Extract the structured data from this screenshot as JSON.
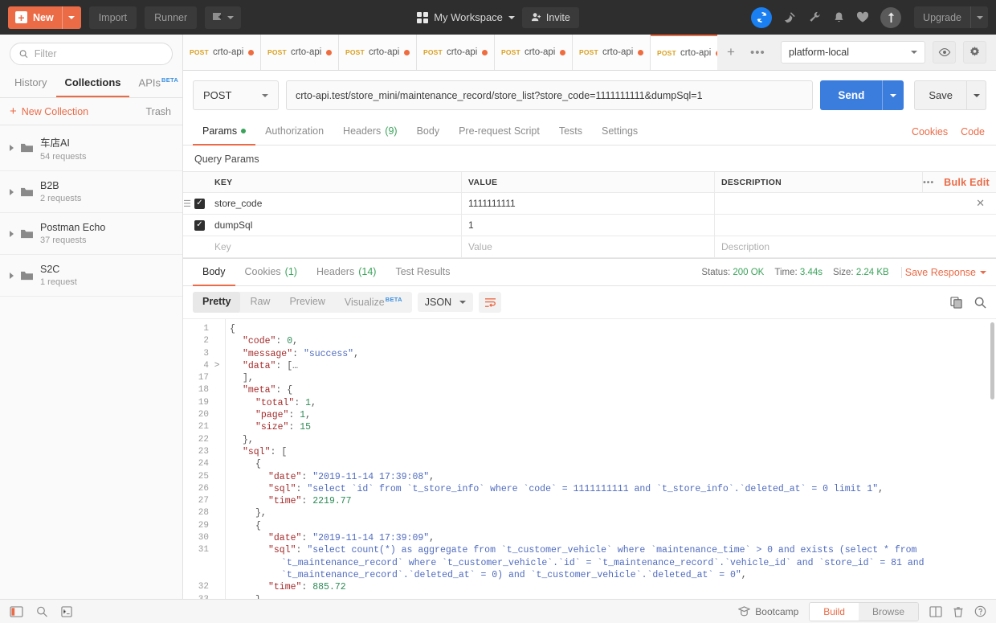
{
  "topbar": {
    "new_label": "New",
    "import_label": "Import",
    "runner_label": "Runner",
    "workspace_label": "My Workspace",
    "invite_label": "Invite",
    "upgrade_label": "Upgrade",
    "icons": [
      "sync-icon",
      "satellite-icon",
      "wrench-icon",
      "bell-icon",
      "heart-icon",
      "upload-icon"
    ]
  },
  "sidebar": {
    "filter_placeholder": "Filter",
    "tabs": [
      {
        "label": "History",
        "active": false
      },
      {
        "label": "Collections",
        "active": true
      },
      {
        "label": "APIs",
        "active": false,
        "sup": "BETA"
      }
    ],
    "new_collection_label": "New Collection",
    "trash_label": "Trash",
    "collections": [
      {
        "name": "车店AI",
        "requests": "54 requests"
      },
      {
        "name": "B2B",
        "requests": "2 requests"
      },
      {
        "name": "Postman Echo",
        "requests": "37 requests"
      },
      {
        "name": "S2C",
        "requests": "1 request"
      }
    ]
  },
  "request_tabs": [
    {
      "method": "POST",
      "name": "crto-api....",
      "unsaved": true,
      "active": false
    },
    {
      "method": "POST",
      "name": "crto-api....",
      "unsaved": true,
      "active": false
    },
    {
      "method": "POST",
      "name": "crto-api....",
      "unsaved": true,
      "active": false
    },
    {
      "method": "POST",
      "name": "crto-api....",
      "unsaved": true,
      "active": false
    },
    {
      "method": "POST",
      "name": "crto-api....",
      "unsaved": true,
      "active": false
    },
    {
      "method": "POST",
      "name": "crto-api....",
      "unsaved": true,
      "active": false
    },
    {
      "method": "POST",
      "name": "crto-api....",
      "unsaved": true,
      "active": true
    }
  ],
  "environment": {
    "selected": "platform-local"
  },
  "url_row": {
    "method": "POST",
    "url": "crto-api.test/store_mini/maintenance_record/store_list?store_code=1111111111&dumpSql=1",
    "send_label": "Send",
    "save_label": "Save"
  },
  "request_tabstrip": {
    "tabs": [
      {
        "label": "Params",
        "active": true,
        "dot": true
      },
      {
        "label": "Authorization",
        "active": false
      },
      {
        "label": "Headers",
        "active": false,
        "count": "(9)"
      },
      {
        "label": "Body",
        "active": false
      },
      {
        "label": "Pre-request Script",
        "active": false
      },
      {
        "label": "Tests",
        "active": false
      },
      {
        "label": "Settings",
        "active": false
      }
    ],
    "cookies_label": "Cookies",
    "code_label": "Code"
  },
  "params": {
    "section_title": "Query Params",
    "headers": {
      "key": "KEY",
      "value": "VALUE",
      "description": "DESCRIPTION",
      "bulk_edit": "Bulk Edit"
    },
    "rows": [
      {
        "checked": true,
        "key": "store_code",
        "value": "1111111111",
        "description": ""
      },
      {
        "checked": true,
        "key": "dumpSql",
        "value": "1",
        "description": ""
      }
    ],
    "placeholder_row": {
      "key": "Key",
      "value": "Value",
      "description": "Description"
    }
  },
  "response": {
    "tabs": [
      {
        "label": "Body",
        "active": true
      },
      {
        "label": "Cookies",
        "active": false,
        "count": "(1)"
      },
      {
        "label": "Headers",
        "active": false,
        "count": "(14)"
      },
      {
        "label": "Test Results",
        "active": false
      }
    ],
    "status_label": "Status:",
    "status_value": "200 OK",
    "time_label": "Time:",
    "time_value": "3.44s",
    "size_label": "Size:",
    "size_value": "2.24 KB",
    "save_response_label": "Save Response",
    "view_modes": [
      {
        "label": "Pretty",
        "active": true
      },
      {
        "label": "Raw",
        "active": false
      },
      {
        "label": "Preview",
        "active": false
      },
      {
        "label": "Visualize",
        "active": false,
        "sup": "BETA"
      }
    ],
    "format": "JSON",
    "code_lines": [
      {
        "num": "1",
        "fold": "",
        "indent": 0,
        "tokens": [
          {
            "t": "{",
            "c": "p"
          }
        ]
      },
      {
        "num": "2",
        "fold": "",
        "indent": 1,
        "tokens": [
          {
            "t": "\"code\"",
            "c": "k"
          },
          {
            "t": ": ",
            "c": "p"
          },
          {
            "t": "0",
            "c": "n"
          },
          {
            "t": ",",
            "c": "p"
          }
        ]
      },
      {
        "num": "3",
        "fold": "",
        "indent": 1,
        "tokens": [
          {
            "t": "\"message\"",
            "c": "k"
          },
          {
            "t": ": ",
            "c": "p"
          },
          {
            "t": "\"success\"",
            "c": "s"
          },
          {
            "t": ",",
            "c": "p"
          }
        ]
      },
      {
        "num": "4",
        "fold": ">",
        "indent": 1,
        "tokens": [
          {
            "t": "\"data\"",
            "c": "k"
          },
          {
            "t": ": […",
            "c": "p"
          }
        ]
      },
      {
        "num": "17",
        "fold": "",
        "indent": 1,
        "tokens": [
          {
            "t": "],",
            "c": "p"
          }
        ]
      },
      {
        "num": "18",
        "fold": "",
        "indent": 1,
        "tokens": [
          {
            "t": "\"meta\"",
            "c": "k"
          },
          {
            "t": ": {",
            "c": "p"
          }
        ]
      },
      {
        "num": "19",
        "fold": "",
        "indent": 2,
        "tokens": [
          {
            "t": "\"total\"",
            "c": "k"
          },
          {
            "t": ": ",
            "c": "p"
          },
          {
            "t": "1",
            "c": "n"
          },
          {
            "t": ",",
            "c": "p"
          }
        ]
      },
      {
        "num": "20",
        "fold": "",
        "indent": 2,
        "tokens": [
          {
            "t": "\"page\"",
            "c": "k"
          },
          {
            "t": ": ",
            "c": "p"
          },
          {
            "t": "1",
            "c": "n"
          },
          {
            "t": ",",
            "c": "p"
          }
        ]
      },
      {
        "num": "21",
        "fold": "",
        "indent": 2,
        "tokens": [
          {
            "t": "\"size\"",
            "c": "k"
          },
          {
            "t": ": ",
            "c": "p"
          },
          {
            "t": "15",
            "c": "n"
          }
        ]
      },
      {
        "num": "22",
        "fold": "",
        "indent": 1,
        "tokens": [
          {
            "t": "},",
            "c": "p"
          }
        ]
      },
      {
        "num": "23",
        "fold": "",
        "indent": 1,
        "tokens": [
          {
            "t": "\"sql\"",
            "c": "k"
          },
          {
            "t": ": [",
            "c": "p"
          }
        ]
      },
      {
        "num": "24",
        "fold": "",
        "indent": 2,
        "tokens": [
          {
            "t": "{",
            "c": "p"
          }
        ]
      },
      {
        "num": "25",
        "fold": "",
        "indent": 3,
        "tokens": [
          {
            "t": "\"date\"",
            "c": "k"
          },
          {
            "t": ": ",
            "c": "p"
          },
          {
            "t": "\"2019-11-14 17:39:08\"",
            "c": "s"
          },
          {
            "t": ",",
            "c": "p"
          }
        ]
      },
      {
        "num": "26",
        "fold": "",
        "indent": 3,
        "tokens": [
          {
            "t": "\"sql\"",
            "c": "k"
          },
          {
            "t": ": ",
            "c": "p"
          },
          {
            "t": "\"select `id` from `t_store_info` where `code` = 1111111111 and `t_store_info`.`deleted_at` = 0 limit 1\"",
            "c": "s"
          },
          {
            "t": ",",
            "c": "p"
          }
        ]
      },
      {
        "num": "27",
        "fold": "",
        "indent": 3,
        "tokens": [
          {
            "t": "\"time\"",
            "c": "k"
          },
          {
            "t": ": ",
            "c": "p"
          },
          {
            "t": "2219.77",
            "c": "n"
          }
        ]
      },
      {
        "num": "28",
        "fold": "",
        "indent": 2,
        "tokens": [
          {
            "t": "},",
            "c": "p"
          }
        ]
      },
      {
        "num": "29",
        "fold": "",
        "indent": 2,
        "tokens": [
          {
            "t": "{",
            "c": "p"
          }
        ]
      },
      {
        "num": "30",
        "fold": "",
        "indent": 3,
        "tokens": [
          {
            "t": "\"date\"",
            "c": "k"
          },
          {
            "t": ": ",
            "c": "p"
          },
          {
            "t": "\"2019-11-14 17:39:09\"",
            "c": "s"
          },
          {
            "t": ",",
            "c": "p"
          }
        ]
      },
      {
        "num": "31",
        "fold": "",
        "indent": 3,
        "tokens": [
          {
            "t": "\"sql\"",
            "c": "k"
          },
          {
            "t": ": ",
            "c": "p"
          },
          {
            "t": "\"select count(*) as aggregate from `t_customer_vehicle` where `maintenance_time` > 0 and exists (select * from",
            "c": "s"
          }
        ]
      },
      {
        "num": "",
        "fold": "",
        "indent": 4,
        "tokens": [
          {
            "t": "`t_maintenance_record` where `t_customer_vehicle`.`id` = `t_maintenance_record`.`vehicle_id` and `store_id` = 81 and",
            "c": "s"
          }
        ]
      },
      {
        "num": "",
        "fold": "",
        "indent": 4,
        "tokens": [
          {
            "t": "`t_maintenance_record`.`deleted_at` = 0) and `t_customer_vehicle`.`deleted_at` = 0\"",
            "c": "s"
          },
          {
            "t": ",",
            "c": "p"
          }
        ]
      },
      {
        "num": "32",
        "fold": "",
        "indent": 3,
        "tokens": [
          {
            "t": "\"time\"",
            "c": "k"
          },
          {
            "t": ": ",
            "c": "p"
          },
          {
            "t": "885.72",
            "c": "n"
          }
        ]
      },
      {
        "num": "33",
        "fold": "",
        "indent": 2,
        "tokens": [
          {
            "t": "},",
            "c": "p"
          }
        ]
      }
    ]
  },
  "footer": {
    "bootcamp_label": "Bootcamp",
    "build_label": "Build",
    "browse_label": "Browse"
  }
}
